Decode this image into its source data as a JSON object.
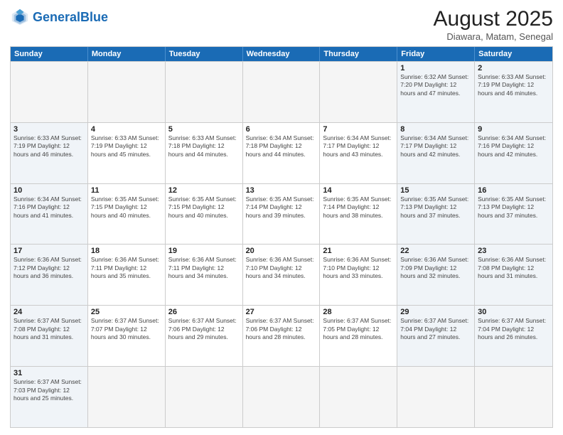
{
  "header": {
    "logo_general": "General",
    "logo_blue": "Blue",
    "main_title": "August 2025",
    "subtitle": "Diawara, Matam, Senegal"
  },
  "calendar": {
    "days_of_week": [
      "Sunday",
      "Monday",
      "Tuesday",
      "Wednesday",
      "Thursday",
      "Friday",
      "Saturday"
    ],
    "rows": [
      [
        {
          "day": "",
          "detail": "",
          "empty": true
        },
        {
          "day": "",
          "detail": "",
          "empty": true
        },
        {
          "day": "",
          "detail": "",
          "empty": true
        },
        {
          "day": "",
          "detail": "",
          "empty": true
        },
        {
          "day": "",
          "detail": "",
          "empty": true
        },
        {
          "day": "1",
          "detail": "Sunrise: 6:32 AM\nSunset: 7:20 PM\nDaylight: 12 hours\nand 47 minutes.",
          "empty": false,
          "weekend": true
        },
        {
          "day": "2",
          "detail": "Sunrise: 6:33 AM\nSunset: 7:19 PM\nDaylight: 12 hours\nand 46 minutes.",
          "empty": false,
          "weekend": true
        }
      ],
      [
        {
          "day": "3",
          "detail": "Sunrise: 6:33 AM\nSunset: 7:19 PM\nDaylight: 12 hours\nand 46 minutes.",
          "empty": false,
          "weekend": true
        },
        {
          "day": "4",
          "detail": "Sunrise: 6:33 AM\nSunset: 7:19 PM\nDaylight: 12 hours\nand 45 minutes.",
          "empty": false
        },
        {
          "day": "5",
          "detail": "Sunrise: 6:33 AM\nSunset: 7:18 PM\nDaylight: 12 hours\nand 44 minutes.",
          "empty": false
        },
        {
          "day": "6",
          "detail": "Sunrise: 6:34 AM\nSunset: 7:18 PM\nDaylight: 12 hours\nand 44 minutes.",
          "empty": false
        },
        {
          "day": "7",
          "detail": "Sunrise: 6:34 AM\nSunset: 7:17 PM\nDaylight: 12 hours\nand 43 minutes.",
          "empty": false
        },
        {
          "day": "8",
          "detail": "Sunrise: 6:34 AM\nSunset: 7:17 PM\nDaylight: 12 hours\nand 42 minutes.",
          "empty": false,
          "weekend": true
        },
        {
          "day": "9",
          "detail": "Sunrise: 6:34 AM\nSunset: 7:16 PM\nDaylight: 12 hours\nand 42 minutes.",
          "empty": false,
          "weekend": true
        }
      ],
      [
        {
          "day": "10",
          "detail": "Sunrise: 6:34 AM\nSunset: 7:16 PM\nDaylight: 12 hours\nand 41 minutes.",
          "empty": false,
          "weekend": true
        },
        {
          "day": "11",
          "detail": "Sunrise: 6:35 AM\nSunset: 7:15 PM\nDaylight: 12 hours\nand 40 minutes.",
          "empty": false
        },
        {
          "day": "12",
          "detail": "Sunrise: 6:35 AM\nSunset: 7:15 PM\nDaylight: 12 hours\nand 40 minutes.",
          "empty": false
        },
        {
          "day": "13",
          "detail": "Sunrise: 6:35 AM\nSunset: 7:14 PM\nDaylight: 12 hours\nand 39 minutes.",
          "empty": false
        },
        {
          "day": "14",
          "detail": "Sunrise: 6:35 AM\nSunset: 7:14 PM\nDaylight: 12 hours\nand 38 minutes.",
          "empty": false
        },
        {
          "day": "15",
          "detail": "Sunrise: 6:35 AM\nSunset: 7:13 PM\nDaylight: 12 hours\nand 37 minutes.",
          "empty": false,
          "weekend": true
        },
        {
          "day": "16",
          "detail": "Sunrise: 6:35 AM\nSunset: 7:13 PM\nDaylight: 12 hours\nand 37 minutes.",
          "empty": false,
          "weekend": true
        }
      ],
      [
        {
          "day": "17",
          "detail": "Sunrise: 6:36 AM\nSunset: 7:12 PM\nDaylight: 12 hours\nand 36 minutes.",
          "empty": false,
          "weekend": true
        },
        {
          "day": "18",
          "detail": "Sunrise: 6:36 AM\nSunset: 7:11 PM\nDaylight: 12 hours\nand 35 minutes.",
          "empty": false
        },
        {
          "day": "19",
          "detail": "Sunrise: 6:36 AM\nSunset: 7:11 PM\nDaylight: 12 hours\nand 34 minutes.",
          "empty": false
        },
        {
          "day": "20",
          "detail": "Sunrise: 6:36 AM\nSunset: 7:10 PM\nDaylight: 12 hours\nand 34 minutes.",
          "empty": false
        },
        {
          "day": "21",
          "detail": "Sunrise: 6:36 AM\nSunset: 7:10 PM\nDaylight: 12 hours\nand 33 minutes.",
          "empty": false
        },
        {
          "day": "22",
          "detail": "Sunrise: 6:36 AM\nSunset: 7:09 PM\nDaylight: 12 hours\nand 32 minutes.",
          "empty": false,
          "weekend": true
        },
        {
          "day": "23",
          "detail": "Sunrise: 6:36 AM\nSunset: 7:08 PM\nDaylight: 12 hours\nand 31 minutes.",
          "empty": false,
          "weekend": true
        }
      ],
      [
        {
          "day": "24",
          "detail": "Sunrise: 6:37 AM\nSunset: 7:08 PM\nDaylight: 12 hours\nand 31 minutes.",
          "empty": false,
          "weekend": true
        },
        {
          "day": "25",
          "detail": "Sunrise: 6:37 AM\nSunset: 7:07 PM\nDaylight: 12 hours\nand 30 minutes.",
          "empty": false
        },
        {
          "day": "26",
          "detail": "Sunrise: 6:37 AM\nSunset: 7:06 PM\nDaylight: 12 hours\nand 29 minutes.",
          "empty": false
        },
        {
          "day": "27",
          "detail": "Sunrise: 6:37 AM\nSunset: 7:06 PM\nDaylight: 12 hours\nand 28 minutes.",
          "empty": false
        },
        {
          "day": "28",
          "detail": "Sunrise: 6:37 AM\nSunset: 7:05 PM\nDaylight: 12 hours\nand 28 minutes.",
          "empty": false
        },
        {
          "day": "29",
          "detail": "Sunrise: 6:37 AM\nSunset: 7:04 PM\nDaylight: 12 hours\nand 27 minutes.",
          "empty": false,
          "weekend": true
        },
        {
          "day": "30",
          "detail": "Sunrise: 6:37 AM\nSunset: 7:04 PM\nDaylight: 12 hours\nand 26 minutes.",
          "empty": false,
          "weekend": true
        }
      ],
      [
        {
          "day": "31",
          "detail": "Sunrise: 6:37 AM\nSunset: 7:03 PM\nDaylight: 12 hours\nand 25 minutes.",
          "empty": false,
          "weekend": true
        },
        {
          "day": "",
          "detail": "",
          "empty": true
        },
        {
          "day": "",
          "detail": "",
          "empty": true
        },
        {
          "day": "",
          "detail": "",
          "empty": true
        },
        {
          "day": "",
          "detail": "",
          "empty": true
        },
        {
          "day": "",
          "detail": "",
          "empty": true
        },
        {
          "day": "",
          "detail": "",
          "empty": true
        }
      ]
    ]
  }
}
